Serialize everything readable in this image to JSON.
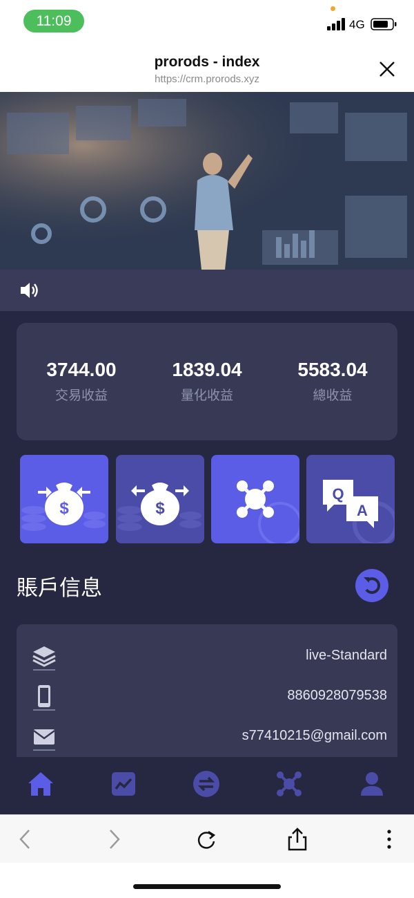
{
  "status_bar": {
    "time": "11:09",
    "network": "4G"
  },
  "browser": {
    "title": "prorods - index",
    "url": "https://crm.prorods.xyz"
  },
  "stats": [
    {
      "value": "3744.00",
      "label": "交易收益"
    },
    {
      "value": "1839.04",
      "label": "量化收益"
    },
    {
      "value": "5583.04",
      "label": "總收益"
    }
  ],
  "tiles": [
    {
      "icon": "money-bag-deposit-icon",
      "color": "#5b5de6"
    },
    {
      "icon": "money-bag-withdraw-icon",
      "color": "#4b4ca8"
    },
    {
      "icon": "network-icon",
      "color": "#5b5de6"
    },
    {
      "icon": "qa-icon",
      "color": "#4b4ca8"
    }
  ],
  "account": {
    "title": "賬戶信息",
    "rows": [
      {
        "icon": "layers-icon",
        "value": "live-Standard"
      },
      {
        "icon": "phone-icon",
        "value": "8860928079538"
      },
      {
        "icon": "mail-icon",
        "value": "s77410215@gmail.com"
      }
    ]
  },
  "nav": [
    "home-icon",
    "chart-icon",
    "exchange-icon",
    "network-icon",
    "user-icon"
  ],
  "colors": {
    "accent": "#5b5de6",
    "background": "#262841",
    "card": "#373955",
    "muted": "#8f92ad"
  }
}
